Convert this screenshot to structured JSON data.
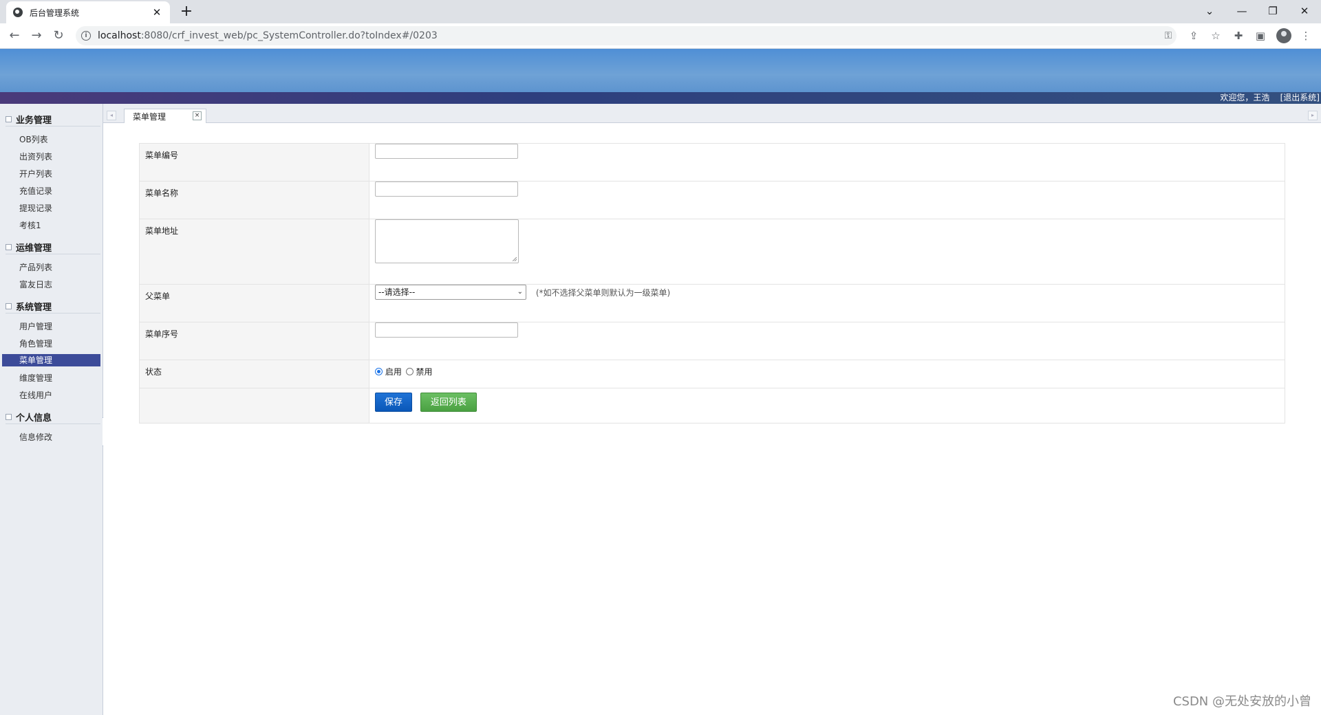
{
  "browser": {
    "tab_title": "后台管理系统",
    "tab_close": "✕",
    "new_tab": "+",
    "url_host": "localhost",
    "url_rest": ":8080/crf_invest_web/pc_SystemController.do?toIndex#/0203",
    "icons": [
      "back-icon",
      "forward-icon",
      "reload-icon",
      "info-icon",
      "key-icon",
      "share-icon",
      "star-icon",
      "extensions-icon",
      "sidepanel-icon",
      "profile-icon",
      "menu-icon"
    ]
  },
  "header": {
    "welcome": "欢迎您，王浩",
    "logout": "[退出系统]",
    "banner_color": "#5f97d3",
    "bar_color": "#33427e"
  },
  "sidebar": {
    "groups": [
      {
        "title": "业务管理",
        "items": [
          "OB列表",
          "出资列表",
          "开户列表",
          "充值记录",
          "提现记录",
          "考核1"
        ]
      },
      {
        "title": "运维管理",
        "items": [
          "产品列表",
          "富友日志"
        ]
      },
      {
        "title": "系统管理",
        "items": [
          "用户管理",
          "角色管理",
          "菜单管理",
          "维度管理",
          "在线用户"
        ]
      },
      {
        "title": "个人信息",
        "items": [
          "信息修改"
        ]
      }
    ],
    "active_item": "菜单管理",
    "active_color": "#3c4b99"
  },
  "tabs": {
    "active": "菜单管理",
    "close": "×"
  },
  "form": {
    "menu_no_label": "菜单编号",
    "menu_no_value": "",
    "menu_name_label": "菜单名称",
    "menu_name_value": "",
    "menu_url_label": "菜单地址",
    "menu_url_value": "",
    "parent_label": "父菜单",
    "parent_selected": "--请选择--",
    "parent_hint": "(*如不选择父菜单则默认为一级菜单)",
    "order_label": "菜单序号",
    "order_value": "",
    "status_label": "状态",
    "status_enabled": "启用",
    "status_disabled": "禁用",
    "status_selected": "启用",
    "save": "保存",
    "back": "返回列表"
  },
  "watermark": "CSDN @无处安放的小曾"
}
